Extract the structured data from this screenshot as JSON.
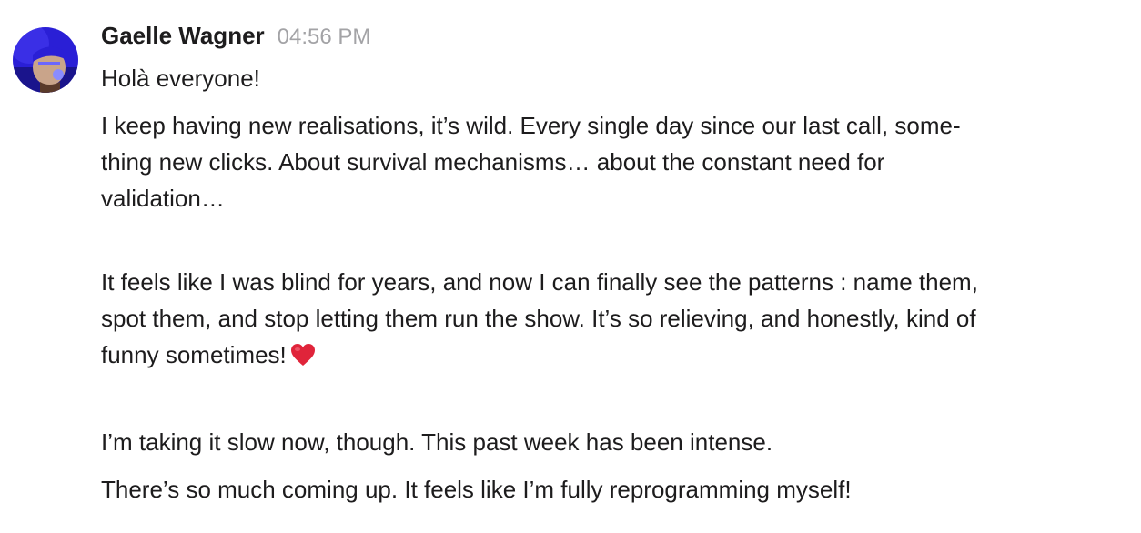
{
  "message": {
    "author": "Gaelle Wagner",
    "timestamp": "04:56 PM",
    "greeting": "Holà everyone!",
    "paragraph1": {
      "line1": "I keep having new realisations, it’s wild. Every single day since our last call, some-",
      "line2": "thing new clicks. About survival mechanisms… about the constant need for",
      "line3": "validation…"
    },
    "paragraph2": {
      "line1": "It feels like I was blind for years, and now I can finally see the patterns : name them,",
      "line2": "spot them, and stop letting them run the show. It’s so relieving, and honestly, kind of",
      "line3": "funny sometimes!"
    },
    "paragraph3": "I’m taking it slow now, though. This past week has been intense.",
    "paragraph4": "There’s so much coming up. It feels like I’m fully reprogramming myself!",
    "emoji": "red-heart-icon"
  },
  "colors": {
    "author": "#1d1c1d",
    "timestamp": "#a3a3a6",
    "heart": "#e0243a",
    "avatar_primary": "#2a1fd6"
  }
}
